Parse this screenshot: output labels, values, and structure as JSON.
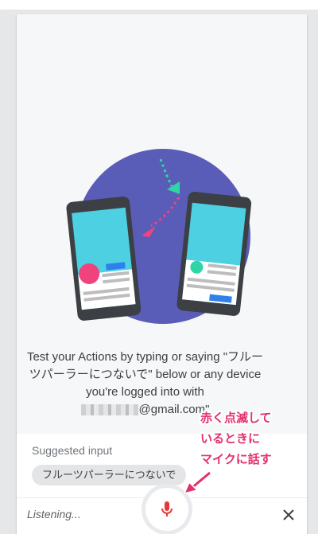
{
  "intro": {
    "line1": "Test your Actions by typing or saying \"フルー",
    "line2": "ツパーラーにつないで\" below or any device",
    "line3": "you're logged into with",
    "email_suffix": "@gmail.com\""
  },
  "suggestions": {
    "title": "Suggested input",
    "chips": [
      "フルーツパーラーにつないで"
    ]
  },
  "input_bar": {
    "status": "Listening..."
  },
  "annotation": {
    "lines": [
      "赤く点滅して",
      "いるときに",
      "マイクに話す"
    ],
    "color": "#e2316d"
  },
  "icons": {
    "mic": "mic-icon",
    "close": "close-icon"
  },
  "colors": {
    "illustration_circle": "#5a5db8",
    "phone_screen": "#4dd0e1",
    "mic_red": "#e53935",
    "accent_pink": "#f0437e",
    "accent_green": "#2ed6a6"
  }
}
